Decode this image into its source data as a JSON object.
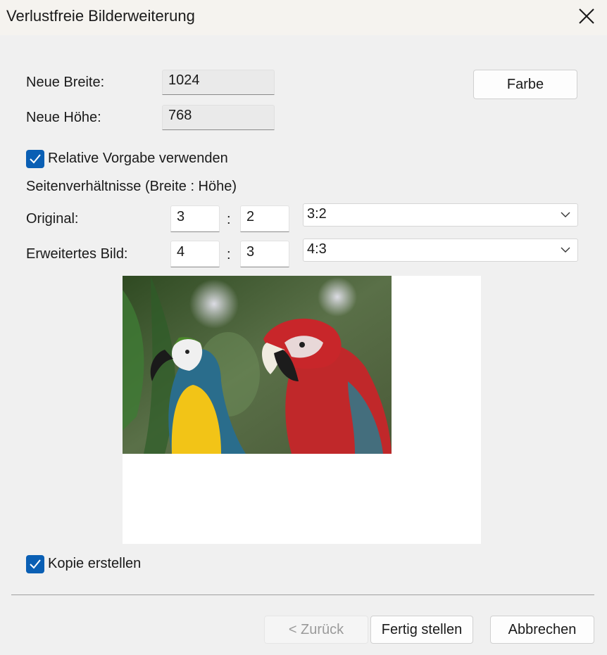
{
  "window": {
    "title": "Verlustfreie Bilderweiterung"
  },
  "size": {
    "width_label": "Neue Breite:",
    "width_value": "1024",
    "height_label": "Neue Höhe:",
    "height_value": "768",
    "color_button": "Farbe"
  },
  "relative": {
    "checkbox_label": "Relative Vorgabe verwenden",
    "checked": true,
    "section_label": "Seitenverhältnisse (Breite : Höhe)"
  },
  "original": {
    "label": "Original:",
    "w": "3",
    "separator": ":",
    "h": "2",
    "preset": "3:2"
  },
  "extended": {
    "label": "Erweitertes Bild:",
    "w": "4",
    "separator": ":",
    "h": "3",
    "preset": "4:3"
  },
  "copy": {
    "checkbox_label": "Kopie erstellen",
    "checked": true
  },
  "footer": {
    "back": "< Zurück",
    "finish": "Fertig stellen",
    "cancel": "Abbrechen"
  },
  "colors": {
    "accent": "#0a5fb4",
    "background": "#f0f0f0",
    "title_bar": "#f5f3ef"
  },
  "icons": {
    "close": "close-icon",
    "check": "checkmark-icon",
    "chevron": "chevron-down-icon"
  }
}
